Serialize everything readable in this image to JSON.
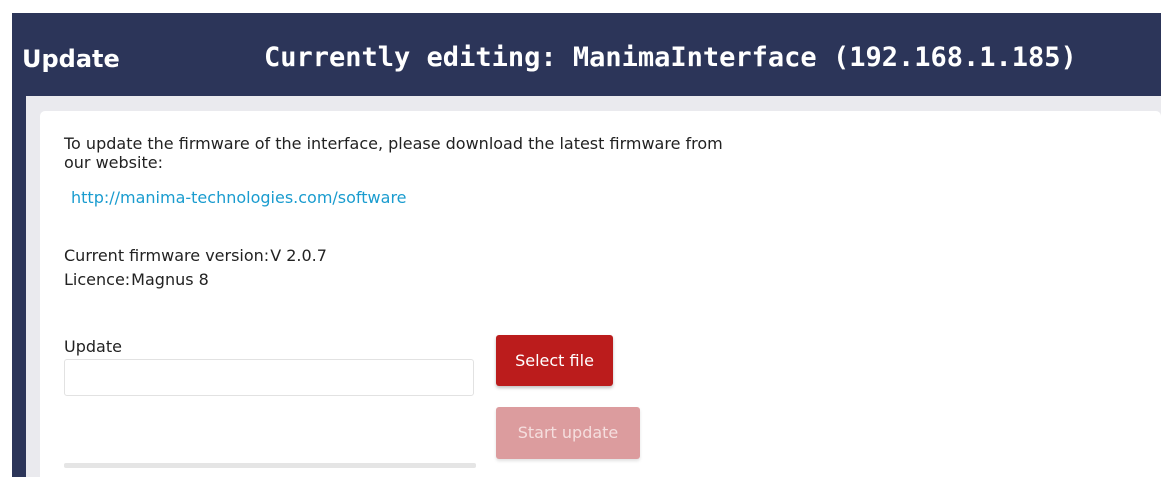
{
  "header": {
    "section_title": "Update",
    "editing_title": "Currently editing: ManimaInterface (192.168.1.185)"
  },
  "intro": {
    "text": "To update the firmware of the interface, please download the latest firmware from our website:",
    "link": "http://manima-technologies.com/software"
  },
  "info": {
    "version_label": "Current firmware version:",
    "version_value": "V 2.0.7",
    "licence_label": "Licence:",
    "licence_value": "Magnus 8"
  },
  "update": {
    "field_label": "Update",
    "file_value": "",
    "select_button": "Select file",
    "start_button": "Start update",
    "progress": 0
  },
  "colors": {
    "header_bg": "#2c3559",
    "accent": "#bb1c1c",
    "accent_disabled": "#dc9c9e",
    "link": "#1a9ccf"
  }
}
